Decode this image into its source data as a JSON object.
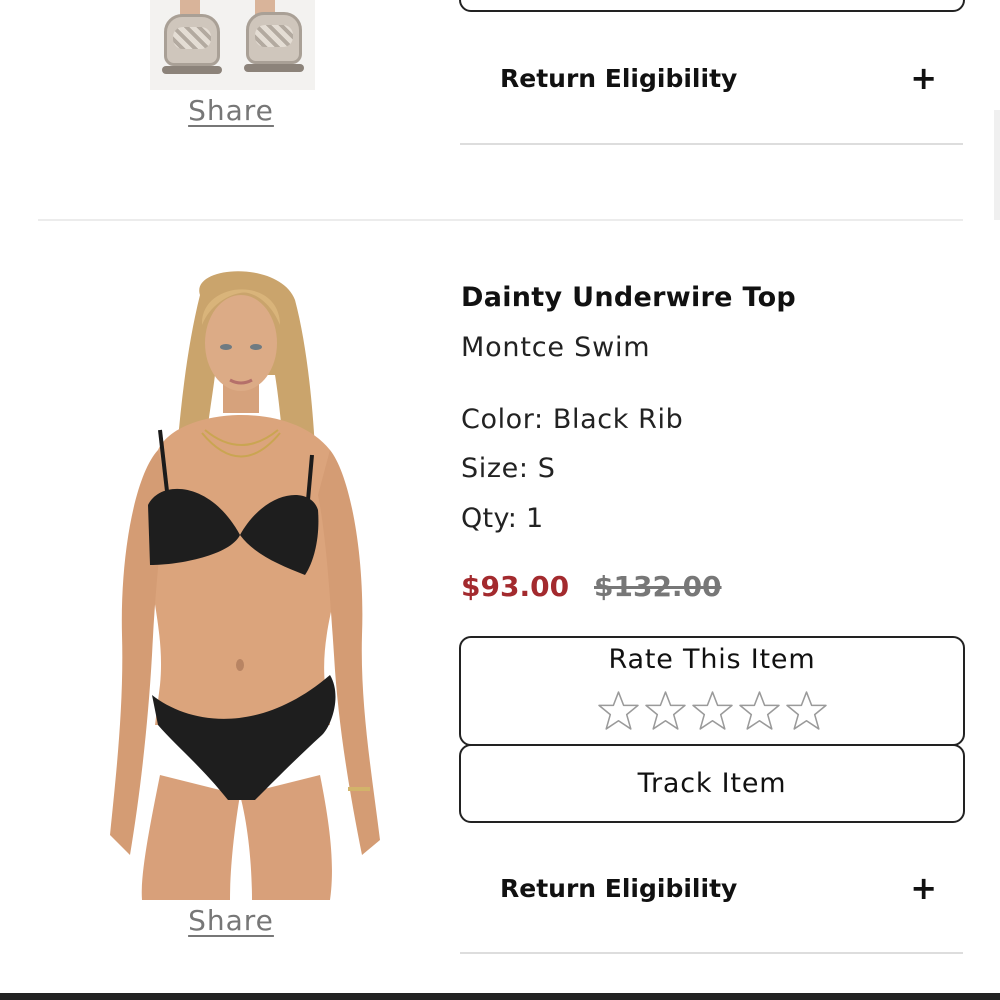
{
  "previous_item": {
    "share_label": "Share",
    "return_eligibility_label": "Return Eligibility",
    "expand_icon": "+"
  },
  "item": {
    "title": "Dainty Underwire Top",
    "brand": "Montce Swim",
    "color": "Color: Black Rib",
    "size": "Size: S",
    "qty": "Qty: 1",
    "price_sale": "$93.00",
    "price_original": "$132.00",
    "rate_label": "Rate This Item",
    "rating_value": 0,
    "rating_max": 5,
    "track_label": "Track Item",
    "share_label": "Share",
    "return_eligibility_label": "Return Eligibility",
    "expand_icon": "+"
  },
  "icons": {
    "star": "star-outline-icon",
    "expand": "plus-icon"
  },
  "colors": {
    "sale_price": "#a32a2e",
    "original_price": "#777777",
    "border": "#222222",
    "divider": "#dddddd",
    "share_link": "#777777"
  }
}
